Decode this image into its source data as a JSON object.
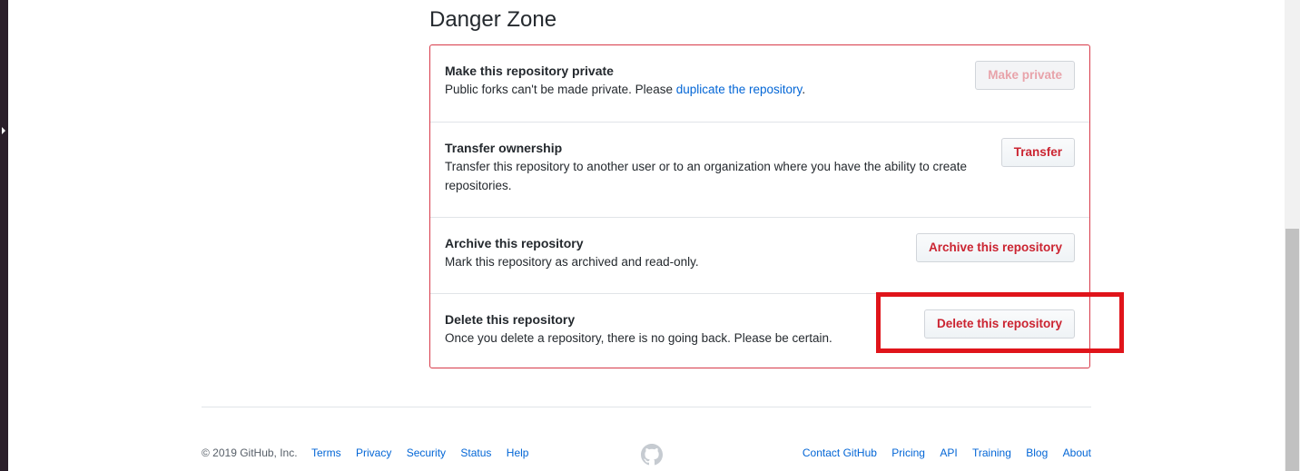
{
  "danger_zone": {
    "title": "Danger Zone",
    "rows": [
      {
        "title": "Make this repository private",
        "description": "Public forks can't be made private. Please ",
        "link": "duplicate the repository",
        "description_suffix": ".",
        "button": "Make private",
        "button_disabled": true
      },
      {
        "title": "Transfer ownership",
        "description": "Transfer this repository to another user or to an organization where you have the ability to create repositories.",
        "button": "Transfer"
      },
      {
        "title": "Archive this repository",
        "description": "Mark this repository as archived and read-only.",
        "button": "Archive this repository"
      },
      {
        "title": "Delete this repository",
        "description": "Once you delete a repository, there is no going back. Please be certain.",
        "button": "Delete this repository"
      }
    ]
  },
  "footer": {
    "copyright": "© 2019 GitHub, Inc.",
    "left_links": [
      "Terms",
      "Privacy",
      "Security",
      "Status",
      "Help"
    ],
    "right_links": [
      "Contact GitHub",
      "Pricing",
      "API",
      "Training",
      "Blog",
      "About"
    ],
    "logo_icon": "github-mark-icon"
  },
  "colors": {
    "danger": "#d73a49",
    "link": "#0366d6",
    "highlight": "#e0141a"
  }
}
